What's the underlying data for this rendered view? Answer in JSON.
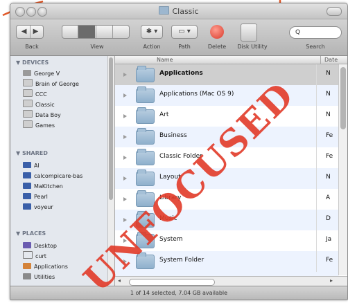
{
  "window": {
    "title": "Classic",
    "status": "1 of 14 selected, 7.04 GB available"
  },
  "toolbar": {
    "back_label": "Back",
    "view_label": "View",
    "action_label": "Action",
    "path_label": "Path",
    "delete_label": "Delete",
    "disk_label": "Disk Utility",
    "search_label": "Search",
    "search_value": "Q"
  },
  "sidebar": {
    "devices_header": "▼ DEVICES",
    "devices": [
      "George V",
      "Brain of George",
      "CCC",
      "Classic",
      "Data Boy",
      "Games"
    ],
    "shared_header": "▼ SHARED",
    "shared": [
      "Al",
      "calcompicare-bas",
      "MaKitchen",
      "Pearl",
      "voyeur"
    ],
    "places_header": "▼ PLACES",
    "places": [
      "Desktop",
      "curt",
      "Applications",
      "Utilities"
    ]
  },
  "list": {
    "name_header": "Name",
    "date_header": "Date",
    "rows": [
      {
        "name": "Applications",
        "date": "N"
      },
      {
        "name": "Applications (Mac OS 9)",
        "date": "N"
      },
      {
        "name": "Art",
        "date": "N"
      },
      {
        "name": "Business",
        "date": "Fe"
      },
      {
        "name": "Classic Folder",
        "date": "Fe"
      },
      {
        "name": "Layout",
        "date": "N"
      },
      {
        "name": "Library",
        "date": "A"
      },
      {
        "name": "Music",
        "date": "D"
      },
      {
        "name": "System",
        "date": "Ja"
      },
      {
        "name": "System Folder",
        "date": "Fe"
      }
    ]
  },
  "overlay": {
    "stamp": "UNFOCUSED",
    "stamp_color": "#e13a28"
  }
}
